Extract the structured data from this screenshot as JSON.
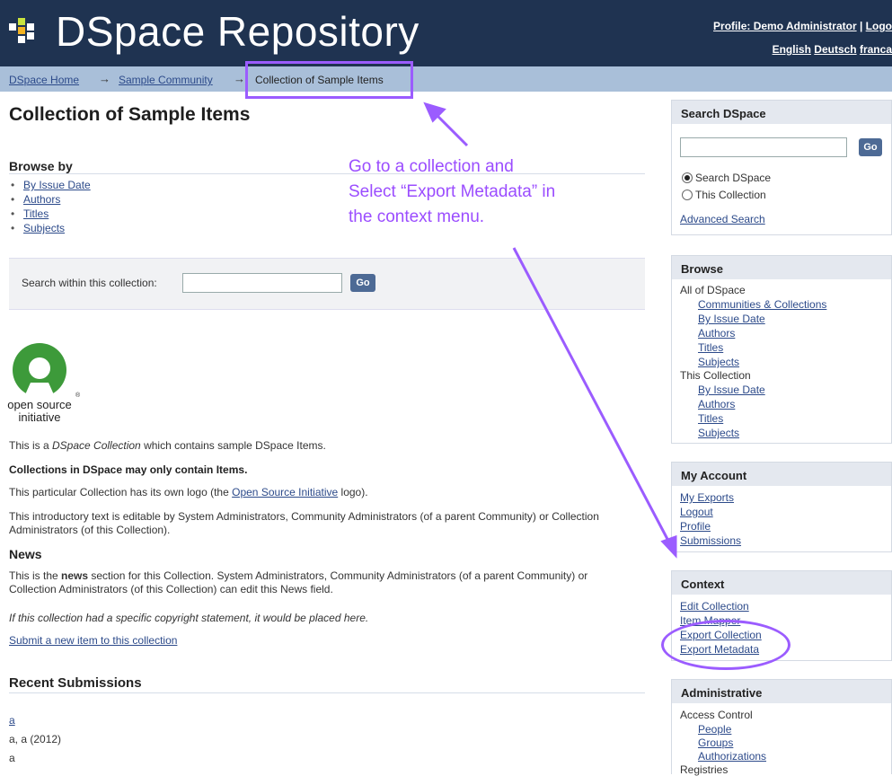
{
  "header": {
    "site_title": "DSpace Repository",
    "profile_link": "Profile: Demo Administrator",
    "separator": "|",
    "logout_link": "Logo",
    "languages": [
      "English",
      "Deutsch",
      "franca"
    ]
  },
  "breadcrumb": {
    "items": [
      "DSpace Home",
      "Sample Community",
      "Collection of Sample Items"
    ],
    "separator": "→"
  },
  "main": {
    "title": "Collection of Sample Items",
    "browse_heading": "Browse by",
    "browse_items": [
      "By Issue Date",
      "Authors",
      "Titles",
      "Subjects"
    ],
    "search_label": "Search within this collection:",
    "search_value": "",
    "search_button": "Go",
    "logo_caption_line1": "open source",
    "logo_caption_line2": "initiative",
    "intro_prefix": "This is a ",
    "intro_em": "DSpace Collection",
    "intro_suffix": " which contains sample DSpace Items.",
    "intro_bold": "Collections in DSpace may only contain Items.",
    "logo_text_prefix": "This particular Collection has its own logo (the ",
    "logo_text_link": "Open Source Initiative",
    "logo_text_suffix": " logo).",
    "editable_text": "This introductory text is editable by System Administrators, Community Administrators (of a parent Community) or Collection Administrators (of this Collection).",
    "news_heading": "News",
    "news_prefix": "This is the ",
    "news_bold": "news",
    "news_suffix": " section for this Collection. System Administrators, Community Administrators (of a parent Community) or Collection Administrators (of this Collection) can edit this News field.",
    "copyright_text": "If this collection had a specific copyright statement, it would be placed here.",
    "submit_link": "Submit a new item to this collection",
    "recent_heading": "Recent Submissions",
    "recent_item_title": "a",
    "recent_item_meta": "a, a (2012)",
    "recent_item_abstract": "a"
  },
  "sidebar": {
    "search": {
      "heading": "Search DSpace",
      "input_value": "",
      "button": "Go",
      "radio_1": "Search DSpace",
      "radio_2": "This Collection",
      "selected": "Search DSpace",
      "advanced": "Advanced Search"
    },
    "browse": {
      "heading": "Browse",
      "all_label": "All of DSpace",
      "all_items": [
        "Communities & Collections",
        "By Issue Date",
        "Authors",
        "Titles",
        "Subjects"
      ],
      "collection_label": "This Collection",
      "collection_items": [
        "By Issue Date",
        "Authors",
        "Titles",
        "Subjects"
      ]
    },
    "account": {
      "heading": "My Account",
      "items": [
        "My Exports",
        "Logout",
        "Profile",
        "Submissions"
      ]
    },
    "context": {
      "heading": "Context",
      "items": [
        "Edit Collection",
        "Item Mapper",
        "Export Collection",
        "Export Metadata"
      ]
    },
    "admin": {
      "heading": "Administrative",
      "access_label": "Access Control",
      "access_items": [
        "People",
        "Groups",
        "Authorizations"
      ],
      "registries_label": "Registries"
    }
  },
  "annotation": {
    "line1": "Go to a collection and",
    "line2": "Select “Export Metadata” in",
    "line3": "the context menu.",
    "color": "#9b5cff"
  },
  "colors": {
    "header_bg": "#1f3351",
    "trail_bg": "#a9bfd9",
    "link": "#2c4a8a",
    "button": "#4d6a95"
  }
}
